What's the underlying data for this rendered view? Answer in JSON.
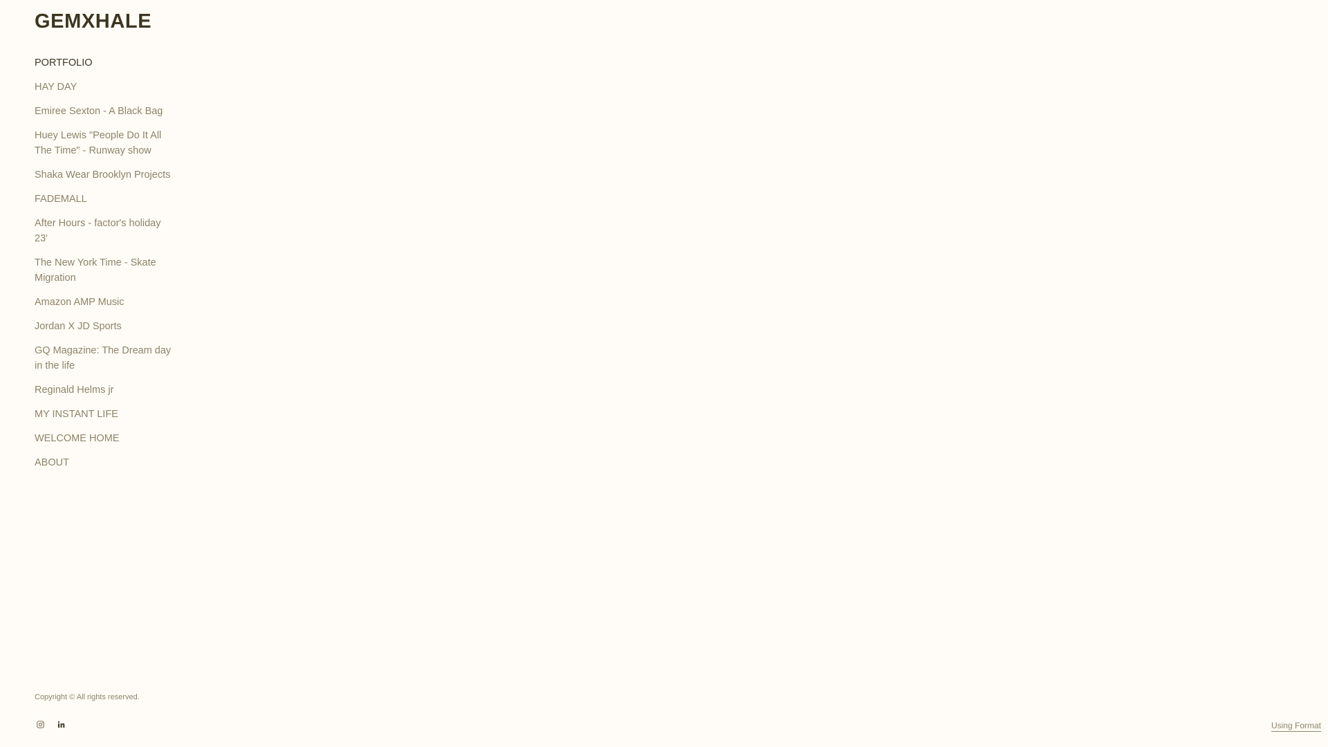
{
  "site": {
    "title": "GEMXHALE"
  },
  "nav": {
    "items": [
      {
        "label": "PORTFOLIO",
        "active": true
      },
      {
        "label": "HAY DAY"
      },
      {
        "label": "Emiree Sexton - A Black Bag"
      },
      {
        "label": "Huey Lewis \"People Do It All The Time\" - Runway show"
      },
      {
        "label": "Shaka Wear Brooklyn Projects"
      },
      {
        "label": "FADEMALL"
      },
      {
        "label": "After Hours - factor's holiday 23'"
      },
      {
        "label": "The New York Time - Skate Migration"
      },
      {
        "label": "Amazon AMP Music"
      },
      {
        "label": "Jordan X JD Sports"
      },
      {
        "label": "GQ Magazine: The Dream day in the life"
      },
      {
        "label": "Reginald Helms jr"
      },
      {
        "label": "MY INSTANT LIFE"
      },
      {
        "label": "WELCOME HOME"
      },
      {
        "label": "ABOUT"
      }
    ]
  },
  "footer": {
    "copyright": "Copyright © All rights reserved.",
    "social": [
      {
        "icon": "instagram-icon"
      },
      {
        "icon": "linkedin-icon"
      }
    ],
    "credit": "Using Format"
  },
  "colors": {
    "background": "#fffcf7",
    "title": "#3d3520",
    "link": "#8f8367",
    "active_link": "#3d3520"
  }
}
